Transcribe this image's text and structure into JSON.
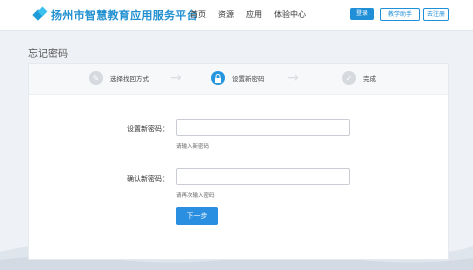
{
  "header": {
    "logo_text": "扬州市智慧教育应用服务平台",
    "nav": [
      "首页",
      "资源",
      "应用",
      "体验中心"
    ],
    "login_label": "登录",
    "helper_label": "教学助手",
    "register_label": "去注册"
  },
  "page_title": "忘记密码",
  "steps": [
    {
      "label": "选择找回方式",
      "icon": "pencil-icon",
      "state": "done"
    },
    {
      "label": "设置新密码",
      "icon": "lock-icon",
      "state": "active"
    },
    {
      "label": "完成",
      "icon": "check-icon",
      "state": "pending"
    }
  ],
  "form": {
    "new_password_label": "设置新密码：",
    "new_password_value": "",
    "new_password_hint": "请输入新密码",
    "confirm_password_label": "确认新密码：",
    "confirm_password_value": "",
    "confirm_password_hint": "请再次输入密码",
    "next_button": "下一步"
  },
  "colors": {
    "accent": "#2596dd",
    "logo": "#1f8fd0",
    "step_inactive": "#d6d9de"
  }
}
